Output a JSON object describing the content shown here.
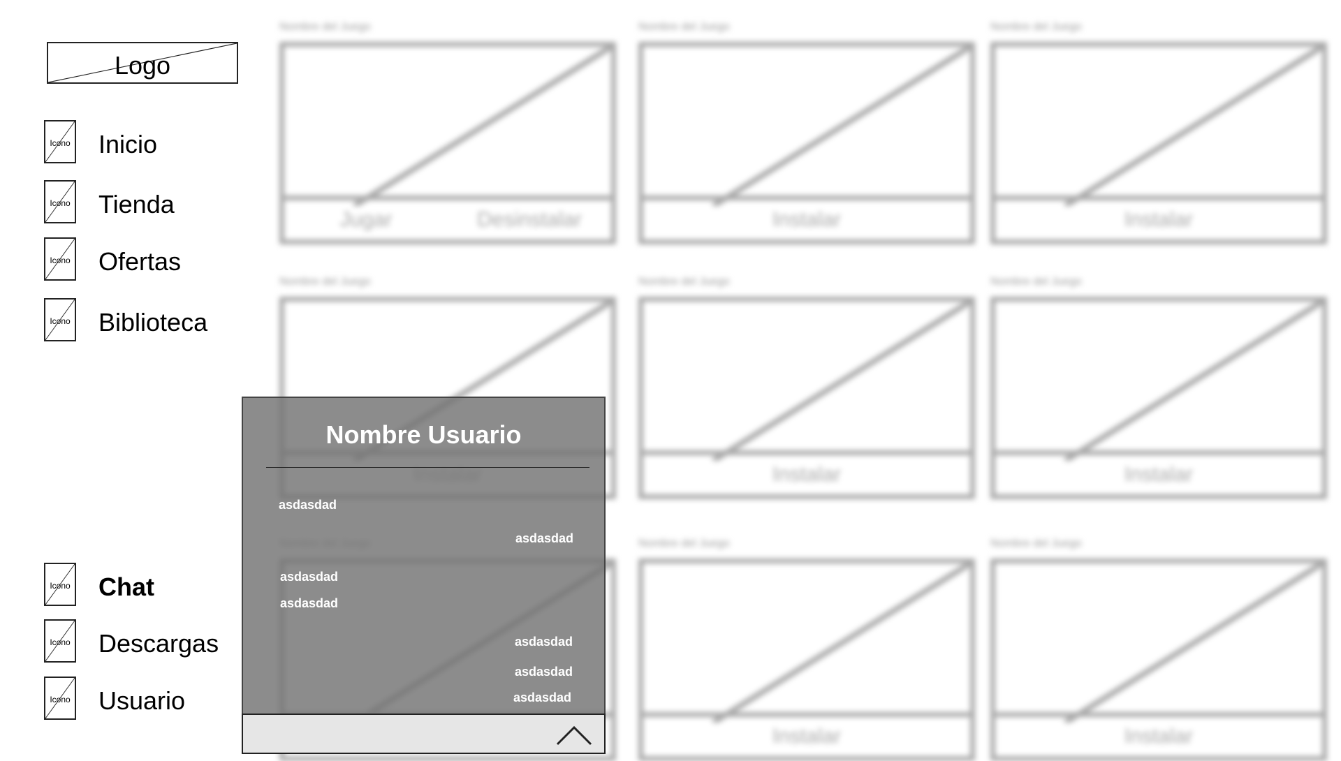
{
  "logo": {
    "label": "Logo"
  },
  "nav": {
    "icon_label": "Icono",
    "top": [
      {
        "label": "Inicio",
        "icon": "placeholder-icon"
      },
      {
        "label": "Tienda",
        "icon": "placeholder-icon"
      },
      {
        "label": "Ofertas",
        "icon": "placeholder-icon"
      },
      {
        "label": "Biblioteca",
        "icon": "placeholder-icon"
      }
    ],
    "bottom": [
      {
        "label": "Chat",
        "icon": "placeholder-icon",
        "active": true
      },
      {
        "label": "Descargas",
        "icon": "placeholder-icon"
      },
      {
        "label": "Usuario",
        "icon": "placeholder-icon"
      }
    ]
  },
  "games": {
    "name_label": "Nombre del Juego",
    "play_label": "Jugar",
    "uninstall_label": "Desinstalar",
    "install_label": "Instalar"
  },
  "chat": {
    "title": "Nombre Usuario",
    "messages": [
      {
        "text": "asdasdad",
        "side": "left"
      },
      {
        "text": "asdasdad",
        "side": "right"
      },
      {
        "text": "asdasdad",
        "side": "left"
      },
      {
        "text": "asdasdad",
        "side": "left"
      },
      {
        "text": "asdasdad",
        "side": "right"
      },
      {
        "text": "asdasdad",
        "side": "right"
      },
      {
        "text": "asdasdad",
        "side": "right"
      }
    ],
    "toggle_icon": "chevron-up-icon"
  }
}
